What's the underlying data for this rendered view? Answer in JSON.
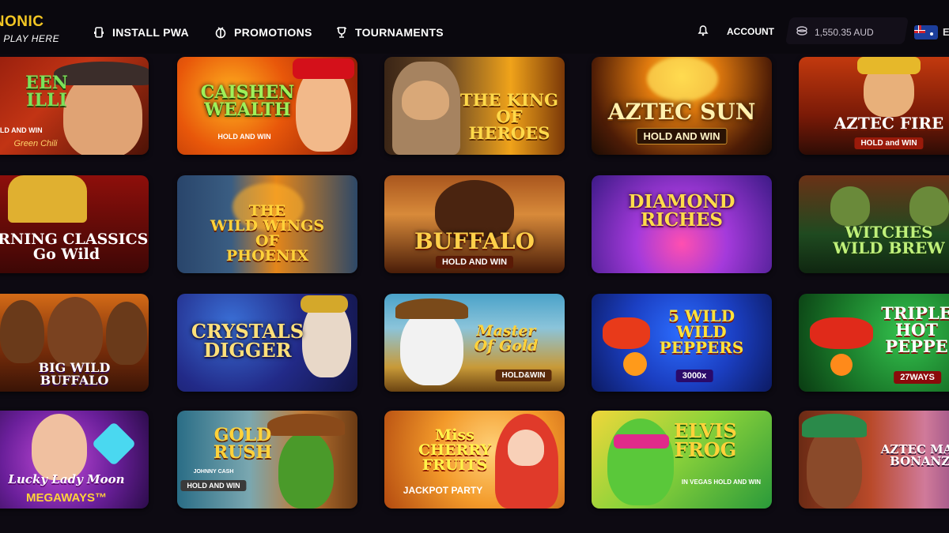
{
  "brand": {
    "logo_text": "INONIC",
    "tagline": "S PLAY HERE"
  },
  "nav": {
    "install": "INSTALL PWA",
    "promotions": "PROMOTIONS",
    "tournaments": "TOURNAMENTS"
  },
  "account": {
    "label": "ACCOUNT",
    "balance": "1,550.35 AUD",
    "lang": "E"
  },
  "colors": {
    "brand_yellow": "#f3c623",
    "background": "#0d0a12"
  },
  "games": [
    {
      "title": "EEN\nILLI",
      "sub": "HOLD AND WIN",
      "extra": "Green Chili"
    },
    {
      "title": "CAISHEN\nWEALTH",
      "sub": "HOLD AND WIN",
      "extra": ""
    },
    {
      "title": "THE KING OF\nHEROES",
      "sub": "",
      "extra": ""
    },
    {
      "title": "AZTEC SUN",
      "sub": "HOLD AND WIN",
      "extra": ""
    },
    {
      "title": "AZTEC FIRE",
      "sub": "HOLD and WIN",
      "extra": ""
    },
    {
      "title": "URNING CLASSICS\nGo Wild",
      "sub": "",
      "extra": ""
    },
    {
      "title": "THE\nWILD WINGS\nOF\nPHOENIX",
      "sub": "",
      "extra": ""
    },
    {
      "title": "BUFFALO",
      "sub": "HOLD AND WIN",
      "extra": ""
    },
    {
      "title": "DIAMOND\nRICHES",
      "sub": "",
      "extra": ""
    },
    {
      "title": "WITCHES\nWILD BREW",
      "sub": "",
      "extra": ""
    },
    {
      "title": "BIG WILD\nBUFFALO",
      "sub": "",
      "extra": ""
    },
    {
      "title": "CRYSTALS\nDIGGER",
      "sub": "",
      "extra": ""
    },
    {
      "title": "Master\nOf Gold",
      "sub": "HOLD&WIN",
      "extra": ""
    },
    {
      "title": "5 WILD\nWILD\nPEPPERS",
      "sub": "3000x",
      "extra": ""
    },
    {
      "title": "TRIPLE\nHOT\nPEPPE",
      "sub": "27WAYS",
      "extra": ""
    },
    {
      "title": "Lucky Lady Moon",
      "sub": "MEGAWAYS™",
      "extra": ""
    },
    {
      "title": "GOLD\nRUSH",
      "sub": "HOLD AND WIN",
      "extra": "JOHNNY CASH"
    },
    {
      "title": "Miss\nCHERRY\nFRUITS",
      "sub": "JACKPOT PARTY",
      "extra": ""
    },
    {
      "title": "ELVIS\nFROG",
      "sub": "IN VEGAS HOLD AND WIN",
      "extra": ""
    },
    {
      "title": "AZTEC MAGI\nBONANZA",
      "sub": "",
      "extra": ""
    }
  ]
}
